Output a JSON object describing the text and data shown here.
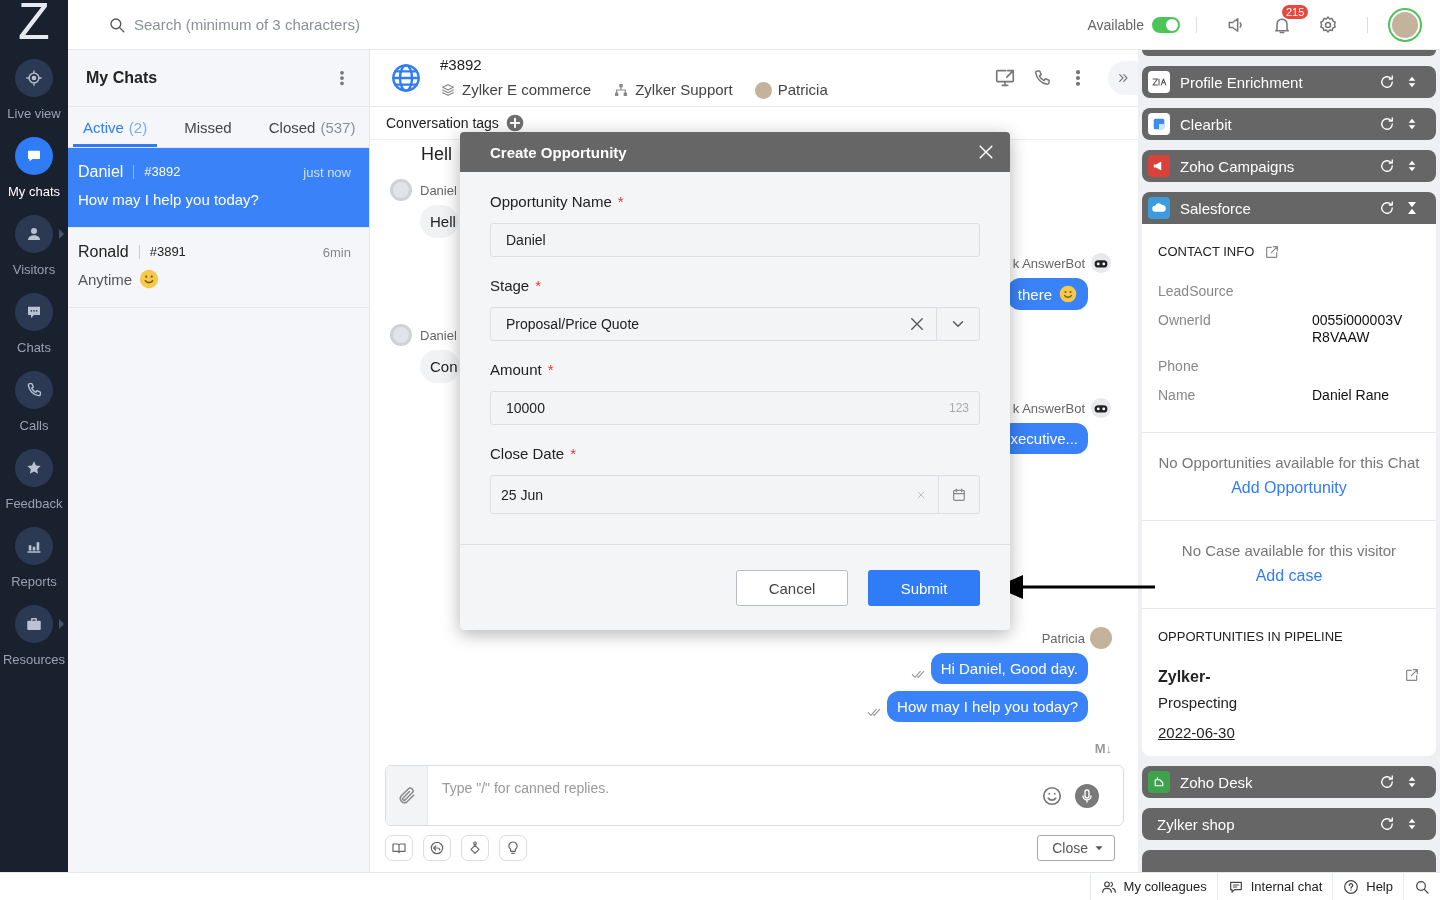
{
  "app": {
    "logo": "Z"
  },
  "nav": [
    {
      "label": "Live view",
      "kind": "crosshair",
      "selected": false,
      "submenu": false
    },
    {
      "label": "My chats",
      "kind": "chat",
      "selected": true,
      "submenu": false
    },
    {
      "label": "Visitors",
      "kind": "person",
      "selected": false,
      "submenu": true
    },
    {
      "label": "Chats",
      "kind": "dots",
      "selected": false,
      "submenu": false
    },
    {
      "label": "Calls",
      "kind": "phone",
      "selected": false,
      "submenu": false
    },
    {
      "label": "Feedback",
      "kind": "star",
      "selected": false,
      "submenu": false
    },
    {
      "label": "Reports",
      "kind": "bars",
      "selected": false,
      "submenu": false
    },
    {
      "label": "Resources",
      "kind": "briefcase",
      "selected": false,
      "submenu": true
    }
  ],
  "top_bar": {
    "search": {
      "placeholder": "Search (minimum of 3 characters)"
    },
    "status_label": "Available",
    "status_on": true,
    "notification_count": "215"
  },
  "chat_list": {
    "title": "My Chats",
    "tabs": [
      {
        "label": "Active",
        "count": "(2)",
        "selected": true
      },
      {
        "label": "Missed",
        "selected": false
      },
      {
        "label": "Closed",
        "count": "(537)",
        "selected": false
      }
    ],
    "items": [
      {
        "name": "Daniel",
        "id": "#3892",
        "time": "just now",
        "preview": "How may I help you today?",
        "emoji": false,
        "selected": true
      },
      {
        "name": "Ronald",
        "id": "#3891",
        "time": "6min",
        "preview": "Anytime",
        "emoji": true,
        "selected": false
      }
    ]
  },
  "conversation": {
    "id": "#3892",
    "website": "Zylker E commerce",
    "department": "Zylker Support",
    "agent": "Patricia",
    "tags_label": "Conversation tags",
    "messages": [
      {
        "kind": "plain",
        "text": "Hell"
      },
      {
        "kind": "visitor",
        "sender": "Daniel",
        "text": "Hell"
      },
      {
        "kind": "bot",
        "sender": "k AnswerBot",
        "text": "there",
        "emoji": true
      },
      {
        "kind": "visitor",
        "sender": "Daniel",
        "text": "Con"
      },
      {
        "kind": "bot",
        "sender": "k AnswerBot",
        "text": "xecutive..."
      },
      {
        "kind": "agent",
        "sender": "Patricia",
        "text": "Hi Daniel, Good day.",
        "read": true
      },
      {
        "kind": "agent",
        "text": "How may I help you today?",
        "read": true
      }
    ],
    "markdown_label": "M↓",
    "composer": {
      "placeholder": "Type \"/\" for canned replies."
    },
    "close_button": "Close"
  },
  "modal": {
    "title": "Create Opportunity",
    "fields": [
      {
        "label": "Opportunity Name",
        "required_mark": "*",
        "kind": "text",
        "value": "Daniel"
      },
      {
        "label": "Stage",
        "required_mark": "*",
        "kind": "select",
        "value": "Proposal/Price Quote"
      },
      {
        "label": "Amount",
        "required_mark": "*",
        "kind": "number",
        "value": "10000",
        "hint": "123"
      },
      {
        "label": "Close Date",
        "required_mark": "*",
        "kind": "date",
        "value": "25 Jun"
      }
    ],
    "buttons": [
      {
        "label": "Cancel",
        "kind": "secondary"
      },
      {
        "label": "Submit",
        "kind": "primary"
      }
    ]
  },
  "side_panel": {
    "widgets": [
      {
        "title": "Profile Enrichment",
        "kind": "zia",
        "color": "#ffffff",
        "expanded": false
      },
      {
        "title": "Clearbit",
        "kind": "clearbit",
        "color": "#ffffff",
        "expanded": false
      },
      {
        "title": "Zoho Campaigns",
        "kind": "megaphone",
        "color": "#d9413a",
        "expanded": false
      },
      {
        "title": "Salesforce",
        "kind": "cloud",
        "color": "#3d9be0",
        "expanded": true,
        "content": {
          "contact_heading": "CONTACT INFO",
          "fields": [
            {
              "label": "LeadSource"
            },
            {
              "label": "OwnerId",
              "value": "0055i000003VR8VAAW"
            },
            {
              "label": "Phone"
            },
            {
              "label": "Name",
              "value": "Daniel Rane"
            }
          ],
          "opportunities": {
            "message": "No Opportunities available for this Chat",
            "link": "Add Opportunity"
          },
          "cases": {
            "message": "No Case available for this visitor",
            "link": "Add case"
          },
          "pipeline": {
            "heading": "OPPORTUNITIES IN PIPELINE",
            "items": [
              {
                "name": "Zylker-",
                "stage": "Prospecting",
                "date": "2022-06-30"
              }
            ]
          }
        }
      },
      {
        "title": "Zoho Desk",
        "kind": "desk",
        "color": "#3fa34d",
        "expanded": false
      },
      {
        "title": "Zylker shop",
        "expanded": false
      }
    ]
  },
  "status_bar": {
    "items": [
      {
        "label": "My colleagues",
        "kind": "people"
      },
      {
        "label": "Internal chat",
        "kind": "ichat"
      },
      {
        "label": "Help",
        "kind": "help"
      },
      {
        "kind": "search"
      }
    ]
  }
}
